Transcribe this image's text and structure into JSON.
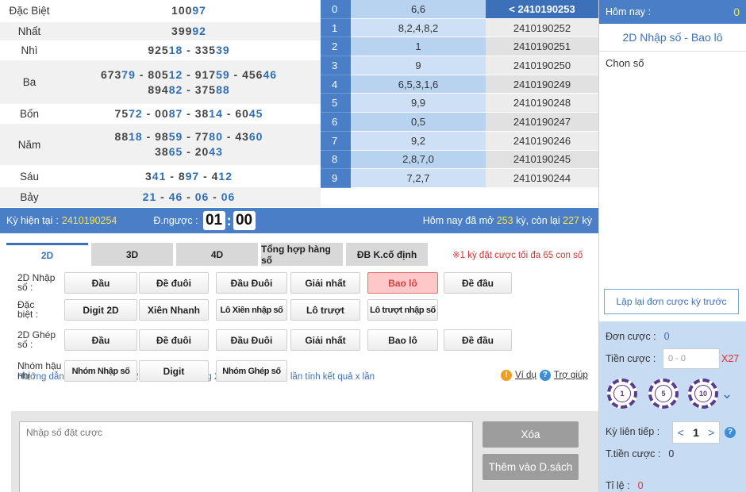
{
  "results": [
    {
      "label": "Đặc Biệt",
      "lines": [
        [
          [
            "100",
            ""
          ],
          [
            "97",
            "b"
          ]
        ]
      ]
    },
    {
      "label": "Nhất",
      "lines": [
        [
          [
            "399",
            ""
          ],
          [
            "92",
            "b"
          ]
        ]
      ]
    },
    {
      "label": "Nhì",
      "lines": [
        [
          [
            "925",
            ""
          ],
          [
            "18",
            "b"
          ],
          [
            " - 335",
            ""
          ],
          [
            "39",
            "b"
          ]
        ]
      ]
    },
    {
      "label": "Ba",
      "lines": [
        [
          [
            "673",
            ""
          ],
          [
            "79",
            "b"
          ],
          [
            " - 805",
            ""
          ],
          [
            "12",
            "b"
          ],
          [
            " - 917",
            ""
          ],
          [
            "59",
            "b"
          ],
          [
            " - 456",
            ""
          ],
          [
            "46",
            "b"
          ]
        ],
        [
          [
            "894",
            ""
          ],
          [
            "82",
            "b"
          ],
          [
            " - 375",
            ""
          ],
          [
            "88",
            "b"
          ]
        ]
      ]
    },
    {
      "label": "Bốn",
      "lines": [
        [
          [
            "75",
            ""
          ],
          [
            "72",
            "b"
          ],
          [
            " - 00",
            ""
          ],
          [
            "87",
            "b"
          ],
          [
            " - 38",
            ""
          ],
          [
            "14",
            "b"
          ],
          [
            " - 60",
            ""
          ],
          [
            "45",
            "b"
          ]
        ]
      ]
    },
    {
      "label": "Năm",
      "lines": [
        [
          [
            "88",
            ""
          ],
          [
            "18",
            "b"
          ],
          [
            " - 98",
            ""
          ],
          [
            "59",
            "b"
          ],
          [
            " - 77",
            ""
          ],
          [
            "80",
            "b"
          ],
          [
            " - 43",
            ""
          ],
          [
            "60",
            "b"
          ]
        ],
        [
          [
            "38",
            ""
          ],
          [
            "65",
            "b"
          ],
          [
            " - 20",
            ""
          ],
          [
            "43",
            "b"
          ]
        ]
      ]
    },
    {
      "label": "Sáu",
      "lines": [
        [
          [
            "3",
            ""
          ],
          [
            "41",
            "b"
          ],
          [
            " - 8",
            ""
          ],
          [
            "97",
            "b"
          ],
          [
            " - 4",
            ""
          ],
          [
            "12",
            "b"
          ]
        ]
      ]
    },
    {
      "label": "Bảy",
      "lines": [
        [
          [
            "21",
            "b"
          ],
          [
            " - ",
            ""
          ],
          [
            "46",
            "b"
          ],
          [
            " - ",
            ""
          ],
          [
            "06",
            "b"
          ],
          [
            " - ",
            ""
          ],
          [
            "06",
            "b"
          ]
        ]
      ]
    }
  ],
  "number_table": [
    {
      "d": "0",
      "nums": "6,6",
      "period": "< 2410190253",
      "current": true
    },
    {
      "d": "1",
      "nums": "8,2,4,8,2",
      "period": "2410190252"
    },
    {
      "d": "2",
      "nums": "1",
      "period": "2410190251"
    },
    {
      "d": "3",
      "nums": "9",
      "period": "2410190250"
    },
    {
      "d": "4",
      "nums": "6,5,3,1,6",
      "period": "2410190249"
    },
    {
      "d": "5",
      "nums": "9,9",
      "period": "2410190248"
    },
    {
      "d": "6",
      "nums": "0,5",
      "period": "2410190247"
    },
    {
      "d": "7",
      "nums": "9,2",
      "period": "2410190246"
    },
    {
      "d": "8",
      "nums": "2,8,7,0",
      "period": "2410190245"
    },
    {
      "d": "9",
      "nums": "7,2,7",
      "period": "2410190244"
    }
  ],
  "status_bar": {
    "period_label": "Kỳ hiện tại",
    "period_value": "2410190254",
    "countdown_label": "Đ.ngược :",
    "minutes": "01",
    "seconds": "00",
    "today_prefix": "Hôm nay đã mở",
    "opened": "253",
    "mid": "kỳ, còn lại",
    "remaining": "227",
    "suffix": "kỳ"
  },
  "tabs": [
    "2D",
    "3D",
    "4D",
    "Tổng hợp hàng số",
    "ĐB K.cố định"
  ],
  "tab_note": "※1 kỳ đặt cược tối đa 65 con số",
  "groups": [
    {
      "label1": "2D Nhập",
      "label2": "số :",
      "buttons": [
        "Đầu",
        "Đề đuôi",
        "Đầu Đuôi",
        "Giải nhất",
        "Bao lô",
        "Đề đầu"
      ]
    },
    {
      "label1": "Đặc",
      "label2": "biệt :",
      "buttons": [
        "Digit 2D",
        "Xiên Nhanh",
        "Lô Xiên nhập số",
        "Lô trượt",
        "Lô trượt nhập số"
      ]
    },
    {
      "label1": "2D Ghép",
      "label2": "số :",
      "buttons": [
        "Đầu",
        "Đề đuôi",
        "Đầu Đuôi",
        "Giải nhất",
        "Bao lô",
        "Đề đầu"
      ]
    },
    {
      "label1": "Nhóm hậu",
      "label2": "nhị :",
      "buttons": [
        "Nhóm Nhập số",
        "Digit",
        "Nhóm Ghép số"
      ]
    }
  ],
  "guide": "Hướng dẫn : Dùng tay nhập 2 chữ số cuối trong 27 lô, nếu số về N lần tính kết quả x lần",
  "example_link": "Ví dụ",
  "help_link": "Trợ giúp",
  "bet_input_placeholder": "Nhập số đặt cược",
  "delete_button": "Xóa",
  "add_list_button": "Thêm vào D.sách",
  "sidebar": {
    "today_label": "Hôm nay :",
    "today_value": "0",
    "game_name": "2D Nhập số - Bao lô",
    "choose": "Chon số",
    "repeat_button": "Lặp lại đơn cược kỳ trước",
    "order_label": "Đơn cược :",
    "order_value": "0",
    "amount_label": "Tiền cược :",
    "amount_placeholder": "0 - 0",
    "multiplier": "X27",
    "chips": [
      "1",
      "5",
      "10"
    ],
    "next_label": "Kỳ liên tiếp :",
    "next_value": "1",
    "total_label": "T.tiền cược :",
    "total_value": "0",
    "rate_label": "Tỉ lệ :",
    "rate_value": "0"
  },
  "colors": {
    "primary": "#4a7fc7",
    "highlight": "#ffe44a",
    "alert": "#e0302e"
  }
}
